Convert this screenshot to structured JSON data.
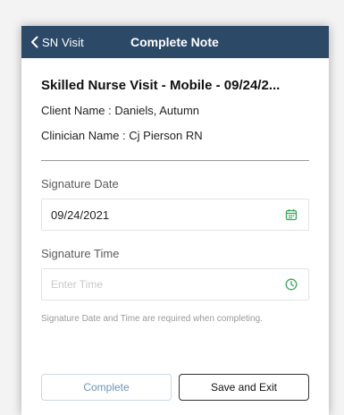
{
  "navbar": {
    "back_label": "SN Visit",
    "title": "Complete Note"
  },
  "note": {
    "title": "Skilled Nurse Visit - Mobile - 09/24/2...",
    "client_line": "Client Name : Daniels, Autumn",
    "clinician_line": "Clinician Name : Cj Pierson RN"
  },
  "signature_date": {
    "label": "Signature Date",
    "value": "09/24/2021",
    "icon": "calendar-icon"
  },
  "signature_time": {
    "label": "Signature Time",
    "placeholder": "Enter Time",
    "icon": "clock-icon"
  },
  "helper_text": "Signature Date and Time are required when completing.",
  "buttons": {
    "complete_label": "Complete",
    "save_exit_label": "Save and Exit"
  },
  "colors": {
    "navbar": "#2c4a68",
    "accent": "#6f95b9",
    "icon_green": "#3aa55b"
  }
}
